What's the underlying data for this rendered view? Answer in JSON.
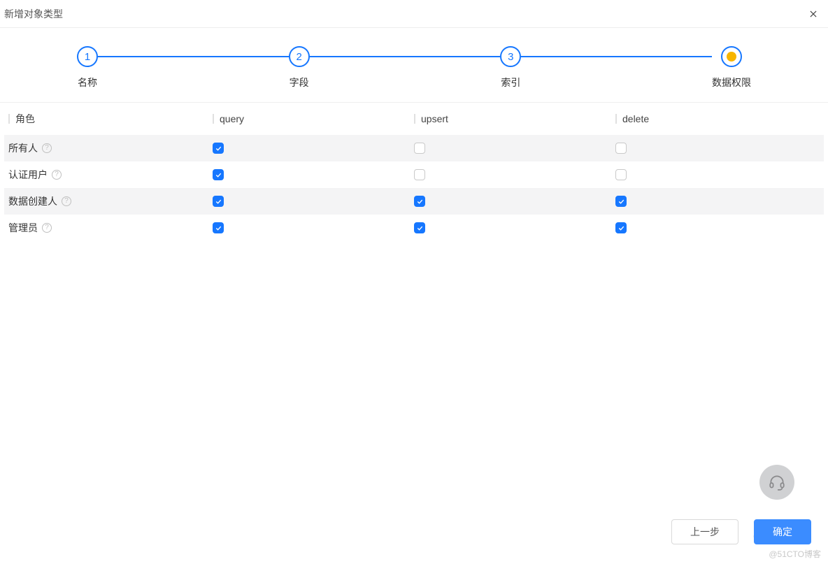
{
  "header": {
    "title": "新增对象类型"
  },
  "steps": [
    {
      "num": "1",
      "label": "名称"
    },
    {
      "num": "2",
      "label": "字段"
    },
    {
      "num": "3",
      "label": "索引"
    },
    {
      "num": "",
      "label": "数据权限",
      "active": true
    }
  ],
  "table": {
    "headers": {
      "role": "角色",
      "query": "query",
      "upsert": "upsert",
      "delete": "delete"
    },
    "rows": [
      {
        "role": "所有人",
        "help": true,
        "query": true,
        "upsert": false,
        "delete": false
      },
      {
        "role": "认证用户",
        "help": true,
        "query": true,
        "upsert": false,
        "delete": false
      },
      {
        "role": "数据创建人",
        "help": true,
        "query": true,
        "upsert": true,
        "delete": true
      },
      {
        "role": "管理员",
        "help": true,
        "query": true,
        "upsert": true,
        "delete": true
      }
    ]
  },
  "footer": {
    "prev": "上一步",
    "ok": "确定"
  },
  "watermark": "@51CTO博客"
}
